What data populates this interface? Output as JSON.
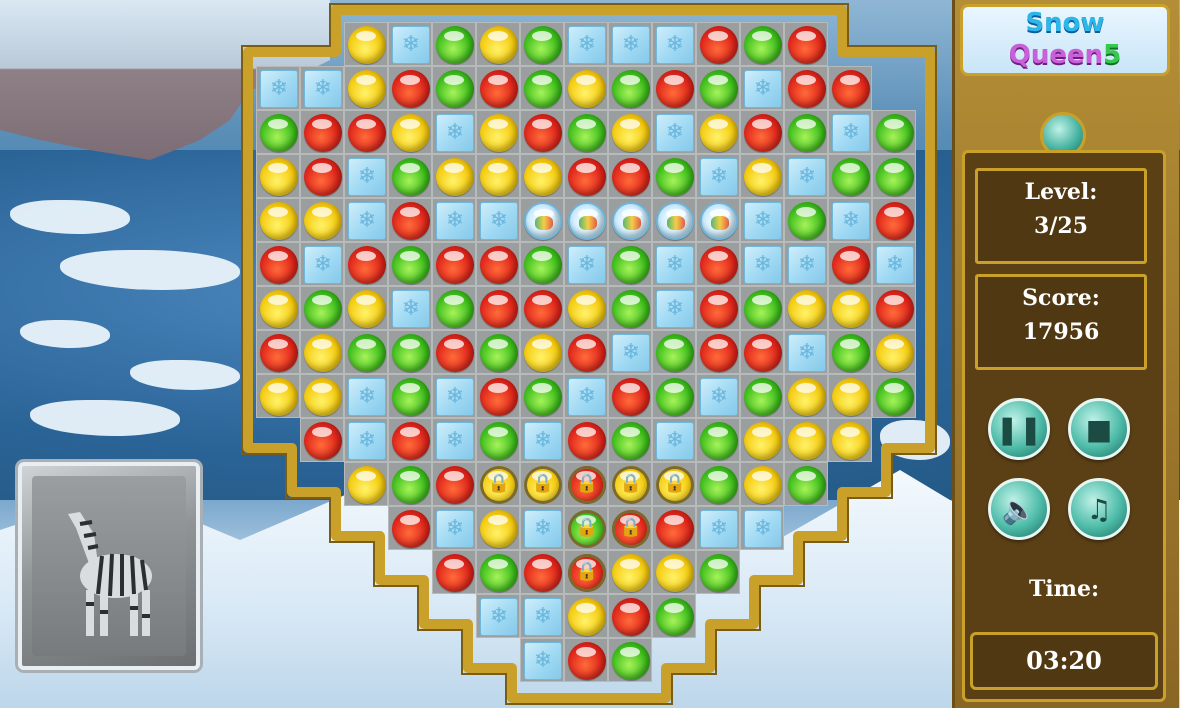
{
  "game": {
    "logo": {
      "line1": "Snow",
      "line2": "Queen",
      "number": "5"
    },
    "level": {
      "label": "Level:",
      "value": "3/25"
    },
    "score": {
      "label": "Score:",
      "value": "17956"
    },
    "time": {
      "label": "Time:",
      "value": "03:20"
    },
    "buttons": {
      "pause": "pause-icon",
      "restart": "restart-icon",
      "sound": "sound-icon",
      "music": "music-icon"
    },
    "collectible_card": {
      "image": "zebra-icon"
    }
  },
  "board": {
    "cols": 15,
    "rows": 15,
    "legend": {
      "r": "red",
      "y": "yellow",
      "g": "green",
      "T": "ice-tile",
      "F": "frozen-gem",
      "L": "locked-gem",
      ".": "empty"
    },
    "grid": [
      "..yTgygTTTrgr..",
      "TTyrgrgygrgTrr.",
      "grryTyrgyTyrgTg",
      "yrTgyyyrrgTyTgg",
      "yyTrTTFFFFFTgTr",
      "rTrgrrgTgTrTTrT",
      "ygyTgrrygTrgyyr",
      "ryggrgyrTgrrTgy",
      "yyTgTrgTrgTgyyg",
      ".rTrTgTrgTgyyy.",
      "..ygrLLLLLgyg..",
      "...rTyTLLrTT...",
      "....rgrLyyg....",
      ".....TTyrg.....",
      "......Trg......"
    ],
    "locked_colors": [
      "y",
      "y",
      "r",
      "y",
      "y",
      "g",
      "r",
      "r"
    ]
  }
}
